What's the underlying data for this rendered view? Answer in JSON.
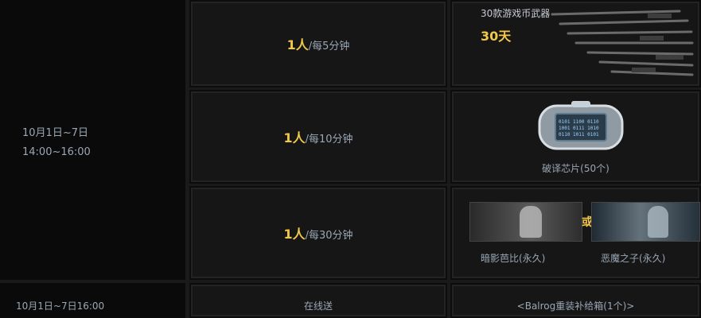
{
  "schedule": {
    "date_range": "10月1日~7日",
    "time_range": "14:00~16:00",
    "bottom_date": "10月1日~7日16:00",
    "bottom_mode": "在线送",
    "bottom_reward": "<Balrog重装补给箱(1个)>"
  },
  "rows": [
    {
      "rate_num": "1人",
      "rate_unit": "/每5分钟"
    },
    {
      "rate_num": "1人",
      "rate_unit": "/每10分钟"
    },
    {
      "rate_num": "1人",
      "rate_unit": "/每30分钟"
    }
  ],
  "rewards": {
    "weapons_title": "30款游戏币武器",
    "weapons_days": "30天",
    "chip_label": "破译芯片(50个)",
    "or_label": "或",
    "char1_label": "暗影芭比(永久)",
    "char2_label": "恶魔之子(永久)"
  }
}
